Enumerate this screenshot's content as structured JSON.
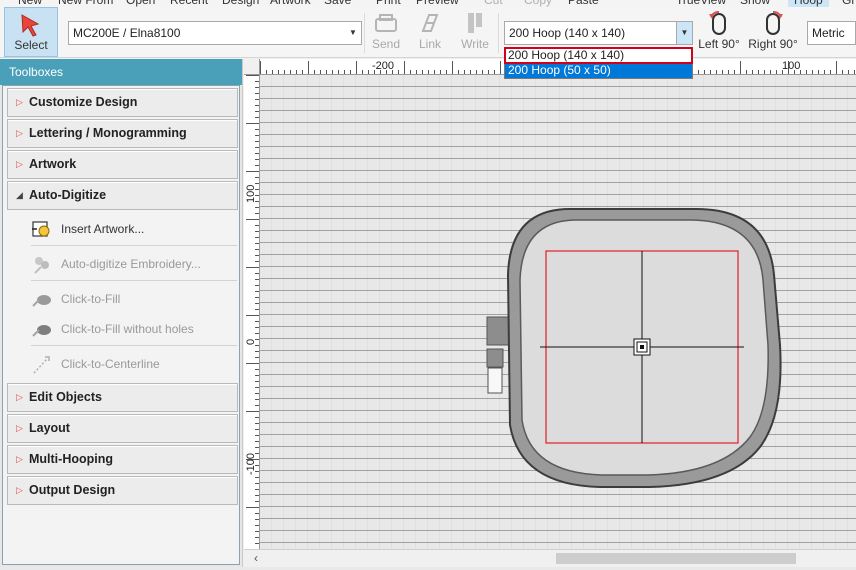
{
  "menu": {
    "items": [
      {
        "label": "New",
        "disabled": false
      },
      {
        "label": "New From",
        "disabled": false
      },
      {
        "label": "Open",
        "disabled": false
      },
      {
        "label": "Recent",
        "disabled": false
      },
      {
        "label": "Design",
        "disabled": false
      },
      {
        "label": "Artwork",
        "disabled": false
      },
      {
        "label": "Save",
        "disabled": false
      },
      {
        "label": "Print",
        "disabled": false
      },
      {
        "label": "Preview",
        "disabled": false
      },
      {
        "label": "Cut",
        "disabled": true
      },
      {
        "label": "Copy",
        "disabled": true
      },
      {
        "label": "Paste",
        "disabled": false
      },
      {
        "label": "TrueView",
        "disabled": false
      },
      {
        "label": "Show",
        "disabled": false
      },
      {
        "label": "Hoop",
        "disabled": false
      },
      {
        "label": "Gr",
        "disabled": false
      }
    ]
  },
  "ribbon": {
    "select_label": "Select",
    "machine_value": "MC200E / Elna8100",
    "send_label": "Send",
    "link_label": "Link",
    "write_label": "Write",
    "hoop_value": "200 Hoop (140 x 140)",
    "left90_label": "Left 90°",
    "right90_label": "Right 90°",
    "units_value": "Metric"
  },
  "hoop_dropdown": {
    "options": [
      {
        "label": "200 Hoop (140 x 140)",
        "selected": false
      },
      {
        "label": "200 Hoop (50 x 50)",
        "selected": true
      }
    ]
  },
  "toolbox": {
    "title": "Toolboxes",
    "sections": [
      {
        "label": "Customize Design",
        "open": false
      },
      {
        "label": "Lettering / Monogramming",
        "open": false
      },
      {
        "label": "Artwork",
        "open": false
      },
      {
        "label": "Auto-Digitize",
        "open": true
      },
      {
        "label": "Edit Objects",
        "open": false
      },
      {
        "label": "Layout",
        "open": false
      },
      {
        "label": "Multi-Hooping",
        "open": false
      },
      {
        "label": "Output Design",
        "open": false
      }
    ],
    "auto_digitize_items": [
      {
        "label": "Insert Artwork...",
        "disabled": false,
        "icon": "insert-artwork-icon"
      },
      {
        "label": "Auto-digitize Embroidery...",
        "disabled": true,
        "icon": "auto-digitize-icon"
      },
      {
        "label": "Click-to-Fill",
        "disabled": true,
        "icon": "click-to-fill-icon"
      },
      {
        "label": "Click-to-Fill without holes",
        "disabled": true,
        "icon": "click-to-fill-no-holes-icon"
      },
      {
        "label": "Click-to-Centerline",
        "disabled": true,
        "icon": "click-to-centerline-icon"
      }
    ]
  },
  "rulers": {
    "top_labels": [
      "-200",
      "100"
    ],
    "left_labels": [
      "100",
      "0",
      "-100"
    ]
  },
  "colors": {
    "accent": "#4aa0b9",
    "selection": "#0078d7",
    "highlight_box": "#d0021b",
    "design_area": "#e0202a"
  }
}
